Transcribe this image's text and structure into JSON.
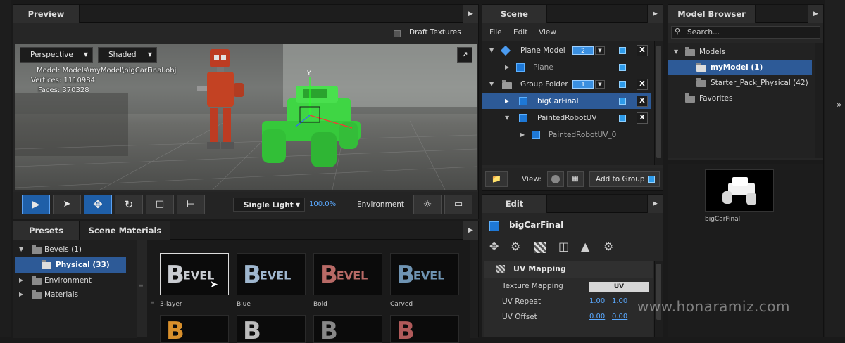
{
  "preview": {
    "tab": "Preview",
    "draft_textures": "Draft Textures",
    "view_mode": "Perspective",
    "shade_mode": "Shaded",
    "model_info": {
      "model_label": "Model:",
      "model_value": "Models\\myModel\\bigCarFinal.obj",
      "vertices_label": "Vertices:",
      "vertices_value": "1110984",
      "faces_label": "Faces:",
      "faces_value": "370328"
    },
    "axis_y": "Y",
    "light_mode": "Single Light",
    "light_percent": "100.0%",
    "environment": "Environment"
  },
  "scene": {
    "tab": "Scene",
    "menu": [
      "File",
      "Edit",
      "View"
    ],
    "items": [
      {
        "label": "Plane Model",
        "badge": "2",
        "type": "diamond",
        "level": 0,
        "expanded": true,
        "has_x": true
      },
      {
        "label": "Plane",
        "type": "cube",
        "level": 1,
        "expanded": false,
        "has_x": false
      },
      {
        "label": "Group Folder",
        "badge": "1",
        "type": "folder",
        "level": 0,
        "expanded": true,
        "has_x": true
      },
      {
        "label": "bigCarFinal",
        "type": "cube",
        "level": 1,
        "expanded": false,
        "has_x": true,
        "selected": true
      },
      {
        "label": "PaintedRobotUV",
        "type": "cube",
        "level": 1,
        "expanded": true,
        "has_x": true
      },
      {
        "label": "PaintedRobotUV_0",
        "type": "cube",
        "level": 2,
        "expanded": false,
        "has_x": false
      }
    ],
    "view_label": "View:",
    "add_to_group": "Add to Group"
  },
  "model_browser": {
    "tab": "Model Browser",
    "search_placeholder": "Search...",
    "tree": [
      {
        "label": "Models",
        "level": 0,
        "expanded": true
      },
      {
        "label": "myModel (1)",
        "level": 1,
        "selected": true
      },
      {
        "label": "Starter_Pack_Physical (42)",
        "level": 1
      },
      {
        "label": "Favorites",
        "level": 0
      }
    ],
    "preview_label": "bigCarFinal"
  },
  "edit": {
    "tab": "Edit",
    "object_name": "bigCarFinal",
    "section": "UV Mapping",
    "texture_mapping_label": "Texture Mapping",
    "texture_mapping_value": "UV",
    "uv_repeat_label": "UV Repeat",
    "uv_repeat_x": "1.00",
    "uv_repeat_y": "1.00",
    "uv_offset_label": "UV Offset",
    "uv_offset_x": "0.00",
    "uv_offset_y": "0.00"
  },
  "presets": {
    "tab_presets": "Presets",
    "tab_materials": "Scene Materials",
    "tree": [
      {
        "label": "Bevels (1)",
        "level": 0,
        "expanded": true
      },
      {
        "label": "Physical (33)",
        "level": 1,
        "selected": true
      },
      {
        "label": "Environment",
        "level": 0
      },
      {
        "label": "Materials",
        "level": 0
      }
    ],
    "thumbs": [
      {
        "label": "3-layer",
        "color": "#c9ccd1"
      },
      {
        "label": "Blue",
        "color": "#9fb7cf"
      },
      {
        "label": "Bold",
        "color": "#b86a66"
      },
      {
        "label": "Carved",
        "color": "#6f94b3"
      }
    ],
    "thumb_text_big": "B",
    "thumb_text_small": "EVEL"
  },
  "watermark": "www.honaramiz.com"
}
